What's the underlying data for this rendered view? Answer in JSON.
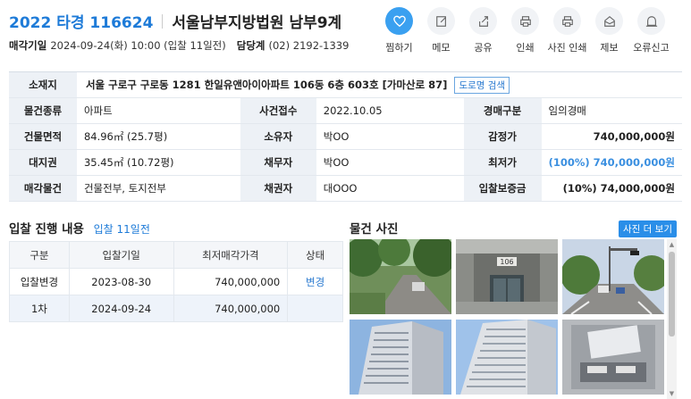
{
  "header": {
    "case_number": "2022 타경 116624",
    "court": "서울남부지방법원 남부9계",
    "sale_date_label": "매각기일",
    "sale_date_value": "2024-09-24(화) 10:00 (입찰 11일전)",
    "manager_label": "담당계",
    "manager_phone": "(02) 2192-1339"
  },
  "actions": [
    {
      "label": "찜하기",
      "icon": "heart-icon"
    },
    {
      "label": "메모",
      "icon": "memo-icon"
    },
    {
      "label": "공유",
      "icon": "share-icon"
    },
    {
      "label": "인쇄",
      "icon": "print-icon"
    },
    {
      "label": "사진 인쇄",
      "icon": "photo-print-icon"
    },
    {
      "label": "제보",
      "icon": "report-icon"
    },
    {
      "label": "오류신고",
      "icon": "error-report-icon"
    }
  ],
  "info": {
    "address_label": "소재지",
    "address": "서울 구로구 구로동 1281 한일유앤아이아파트 106동 6층 603호 [가마산로 87]",
    "road_search": "도로명 검색",
    "rows": [
      {
        "l1": "물건종류",
        "v1": "아파트",
        "l2": "사건접수",
        "v2": "2022.10.05",
        "l3": "경매구분",
        "v3": "임의경매"
      },
      {
        "l1": "건물면적",
        "v1": "84.96㎡ (25.7평)",
        "l2": "소유자",
        "v2": "박OO",
        "l3": "감정가",
        "v3": "740,000,000원"
      },
      {
        "l1": "대지권",
        "v1": "35.45㎡ (10.72평)",
        "l2": "채무자",
        "v2": "박OO",
        "l3": "최저가",
        "v3": "(100%) 740,000,000원"
      },
      {
        "l1": "매각물건",
        "v1": "건물전부, 토지전부",
        "l2": "채권자",
        "v2": "대OOO",
        "l3": "입찰보증금",
        "v3": "(10%) 74,000,000원"
      }
    ]
  },
  "bidding": {
    "title": "입찰 진행 내용",
    "countdown": "입찰 11일전",
    "headers": [
      "구분",
      "입찰기일",
      "최저매각가격",
      "상태"
    ],
    "rows": [
      {
        "type": "입찰변경",
        "date": "2023-08-30",
        "price": "740,000,000",
        "status": "변경"
      },
      {
        "type": "1차",
        "date": "2024-09-24",
        "price": "740,000,000",
        "status": ""
      }
    ]
  },
  "photos": {
    "title": "물건 사진",
    "more": "사진 더 보기",
    "items": [
      "tree-lined-road-photo",
      "apartment-entrance-photo",
      "street-intersection-photo",
      "apartment-building-photo",
      "apartment-tower-photo",
      "mailbox-photo"
    ],
    "entrance_sign": "106"
  },
  "colors": {
    "accent": "#1e7bd8",
    "table_header": "#edf1f6",
    "heart_active": "#3aa0f0"
  }
}
